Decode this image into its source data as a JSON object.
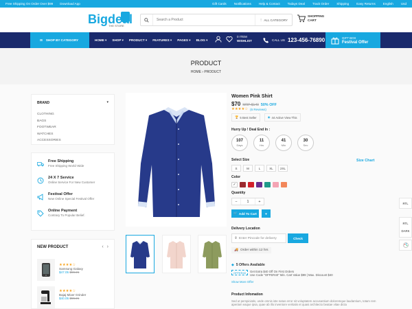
{
  "topbar": {
    "left": [
      "Free Shipping On Order Over $99",
      "Download App"
    ],
    "right": [
      "Gift Cards",
      "Notifications",
      "Help & Contact",
      "Todays Deal",
      "Track Order",
      "Shipping",
      "Easy Returns",
      "English",
      "Usd"
    ]
  },
  "header": {
    "logo_main": "Bigdeal",
    "logo_sub": "THE STORE",
    "search_placeholder": "Search a Product",
    "category_label": "ALL CATEGORY",
    "cart_line1": "SHOPPING",
    "cart_line2": "CART"
  },
  "nav": {
    "shop_by_category": "SHOP BY CATEGORY",
    "menu": [
      "HOME",
      "SHOP",
      "PRODUCT",
      "FEATURES",
      "PAGES",
      "BLOG"
    ],
    "wishlist_count": "0 ITEM",
    "wishlist_label": "WISHLIST",
    "call_label": "CALL US",
    "phone": "123-456-76890",
    "gift_line1": "GIFT BOX",
    "gift_line2": "Festival Offer"
  },
  "page": {
    "title": "PRODUCT",
    "breadcrumb_home": "HOME",
    "breadcrumb_current": "PRODUCT"
  },
  "filters": {
    "heading": "BRAND",
    "items": [
      "CLOTHING",
      "BAGS",
      "FOOTWEAR",
      "WATCHES",
      "ACCESSORIES"
    ]
  },
  "services": [
    {
      "title": "Free Shipping",
      "desc": "Free Shipping World Wide",
      "icon": "truck-icon"
    },
    {
      "title": "24 X 7 Service",
      "desc": "Online Service For New Customer",
      "icon": "clock-icon"
    },
    {
      "title": "Festival Offer",
      "desc": "New Online Special Festival Offer",
      "icon": "megaphone-icon"
    },
    {
      "title": "Online Payment",
      "desc": "Contrary To Popular Belief.",
      "icon": "tag-icon"
    }
  ],
  "new_product": {
    "heading": "NEW PRODUCT",
    "items": [
      {
        "name": "Samsung Galaxy",
        "price": "$47.05",
        "old": "$55.21",
        "rating": 4
      },
      {
        "name": "Bajaj Mixer Grinder",
        "price": "$40.05",
        "old": "$55.21",
        "rating": 4
      }
    ]
  },
  "product": {
    "name": "Women Pink Shirt",
    "price": "$70",
    "mrp": "MRP $140",
    "discount": "50% OFF",
    "rating": 4,
    "reviews": "(6 Reviews)",
    "chip_seller": "5 Best Seller",
    "chip_views": "44 Active View This",
    "hurry": "Hurry Up ! Deal End In :",
    "timer": [
      {
        "value": "107",
        "label": "Days"
      },
      {
        "value": "11",
        "label": "Hrs"
      },
      {
        "value": "41",
        "label": "Min"
      },
      {
        "value": "30",
        "label": "Sec"
      }
    ],
    "size_label": "Select Size",
    "size_chart": "Size Chart",
    "sizes": [
      "S",
      "M",
      "L",
      "XL",
      "2XL"
    ],
    "color_label": "Color",
    "colors": [
      "#ffffff",
      "#9b2a2e",
      "#d2202a",
      "#6a2c8e",
      "#1f9a8a",
      "#f4a4b4",
      "#f2875a"
    ],
    "quantity_label": "Quantity",
    "quantity": "1",
    "add_to_cart": "Add To Cart",
    "delivery_label": "Delivery Location",
    "pin_placeholder": "Enter Pincode for delivery",
    "check": "Check",
    "order_within": "Order within 12 hrs",
    "offers_heading": "5 Offers Available",
    "offer_code": "OFFER40",
    "offer_title": "Get Extra $40 Off On First Orders",
    "offer_desc": "Use Code \"OFFER40\" Min. Cart Value $99 | Max. Discount $40",
    "show_more": "Show More Offer",
    "info_heading": "Product Infomation",
    "info_desc": "Sed ut perspiciatis, unde omnis iste natus error sit voluptatem accusantium doloremque laudantium, totam rem aperiam eaque ipsa, quae ab illo inventore veritatis et quasi architecto beatae vitae dicta"
  },
  "side": {
    "rtl": "RTL",
    "rtl2": "RTL",
    "dark": "DARK"
  },
  "colors": {
    "accent": "#18a8e0",
    "nav": "#1a2a6c"
  }
}
